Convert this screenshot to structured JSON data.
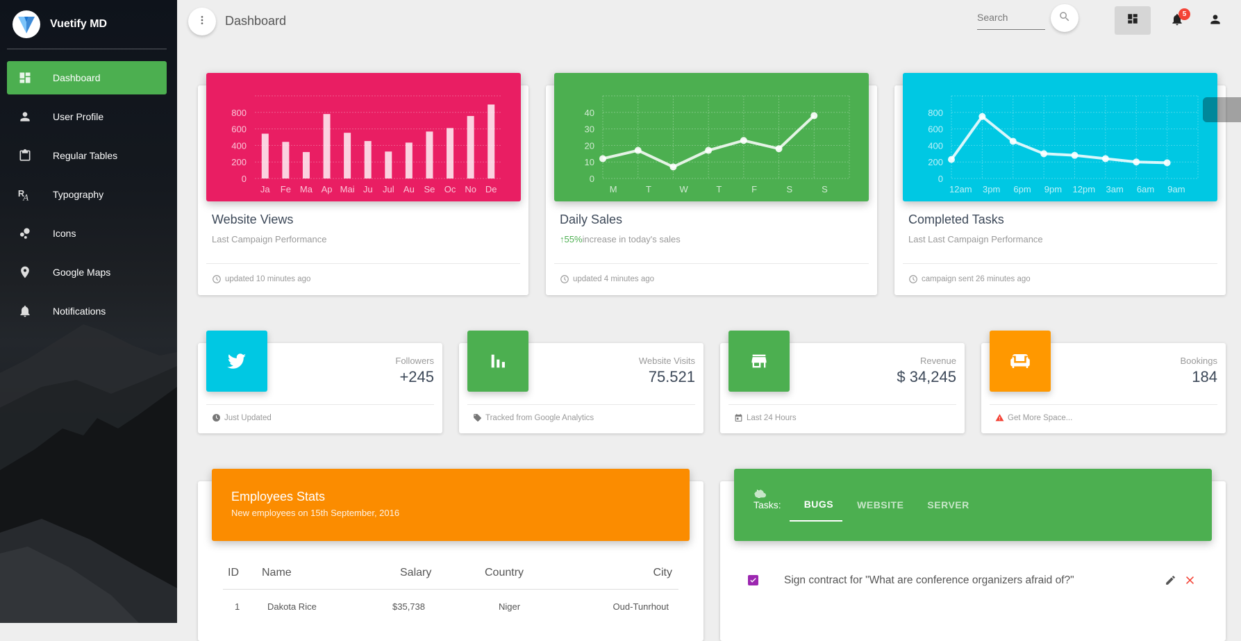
{
  "app": {
    "brand": "Vuetify MD",
    "page_title": "Dashboard"
  },
  "sidebar": {
    "items": [
      {
        "label": "Dashboard",
        "icon": "dashboard-icon",
        "active": true
      },
      {
        "label": "User Profile",
        "icon": "person-icon",
        "active": false
      },
      {
        "label": "Regular Tables",
        "icon": "clipboard-icon",
        "active": false
      },
      {
        "label": "Typography",
        "icon": "typography-icon",
        "active": false
      },
      {
        "label": "Icons",
        "icon": "bubble-chart-icon",
        "active": false
      },
      {
        "label": "Google Maps",
        "icon": "map-pin-icon",
        "active": false
      },
      {
        "label": "Notifications",
        "icon": "bell-icon",
        "active": false
      }
    ]
  },
  "toolbar": {
    "search_placeholder": "Search",
    "search_value": "",
    "notification_count": "5"
  },
  "chart_cards": [
    {
      "title": "Website Views",
      "subtitle": "Last Campaign Performance",
      "footer": "updated 10 minutes ago",
      "color": "#e91e63"
    },
    {
      "title": "Daily Sales",
      "subtitle_highlight": "55%",
      "subtitle": "increase in today's sales",
      "footer": "updated 4 minutes ago",
      "color": "#4caf50"
    },
    {
      "title": "Completed Tasks",
      "subtitle": "Last Last Campaign Performance",
      "footer": "campaign sent 26 minutes ago",
      "color": "#00c8e3"
    }
  ],
  "chart_data": [
    {
      "type": "bar",
      "title": "Website Views",
      "categories": [
        "Ja",
        "Fe",
        "Ma",
        "Ap",
        "Mai",
        "Ju",
        "Jul",
        "Au",
        "Se",
        "Oc",
        "No",
        "De"
      ],
      "values": [
        542,
        443,
        320,
        780,
        553,
        453,
        326,
        434,
        568,
        610,
        756,
        895
      ],
      "yticks": [
        "0",
        "200",
        "400",
        "600",
        "800"
      ],
      "ylim": [
        0,
        1000
      ],
      "grid": true
    },
    {
      "type": "line",
      "title": "Daily Sales",
      "categories": [
        "M",
        "T",
        "W",
        "T",
        "F",
        "S",
        "S"
      ],
      "values": [
        12,
        17,
        7,
        17,
        23,
        18,
        38
      ],
      "yticks": [
        "0",
        "10",
        "20",
        "30",
        "40"
      ],
      "ylim": [
        0,
        50
      ],
      "grid": true
    },
    {
      "type": "line",
      "title": "Completed Tasks",
      "categories": [
        "12am",
        "3pm",
        "6pm",
        "9pm",
        "12pm",
        "3am",
        "6am",
        "9am"
      ],
      "values": [
        230,
        750,
        450,
        300,
        280,
        240,
        200,
        190
      ],
      "yticks": [
        "0",
        "200",
        "400",
        "600",
        "800"
      ],
      "ylim": [
        0,
        1000
      ],
      "grid": true
    }
  ],
  "stats": [
    {
      "label": "Followers",
      "value": "+245",
      "footer": "Just Updated",
      "icon": "twitter-icon",
      "footer_icon": "clock-icon",
      "color": "#00c8e3"
    },
    {
      "label": "Website Visits",
      "value": "75.521",
      "footer": "Tracked from Google Analytics",
      "icon": "bar-chart-icon",
      "footer_icon": "tag-icon",
      "color": "#4caf50"
    },
    {
      "label": "Revenue",
      "value": "$ 34,245",
      "footer": "Last 24 Hours",
      "icon": "store-icon",
      "footer_icon": "calendar-icon",
      "color": "#4caf50"
    },
    {
      "label": "Bookings",
      "value": "184",
      "footer": "Get More Space...",
      "icon": "sofa-icon",
      "footer_icon": "warning-icon",
      "color": "#ff9800"
    }
  ],
  "employees": {
    "title": "Employees Stats",
    "subtitle": "New employees on 15th September, 2016",
    "color": "#fb8c00",
    "columns": [
      "ID",
      "Name",
      "Salary",
      "Country",
      "City"
    ],
    "rows": [
      [
        "1",
        "Dakota Rice",
        "$35,738",
        "Niger",
        "Oud-Tunrhout"
      ]
    ]
  },
  "tasks": {
    "label": "Tasks:",
    "tabs": [
      {
        "label": "BUGS",
        "icon": "bug-icon",
        "active": true
      },
      {
        "label": "WEBSITE",
        "icon": "code-icon",
        "active": false
      },
      {
        "label": "SERVER",
        "icon": "cloud-icon",
        "active": false
      }
    ],
    "items": [
      {
        "text": "Sign contract for \"What are conference organizers afraid of?\"",
        "checked": true
      }
    ]
  }
}
